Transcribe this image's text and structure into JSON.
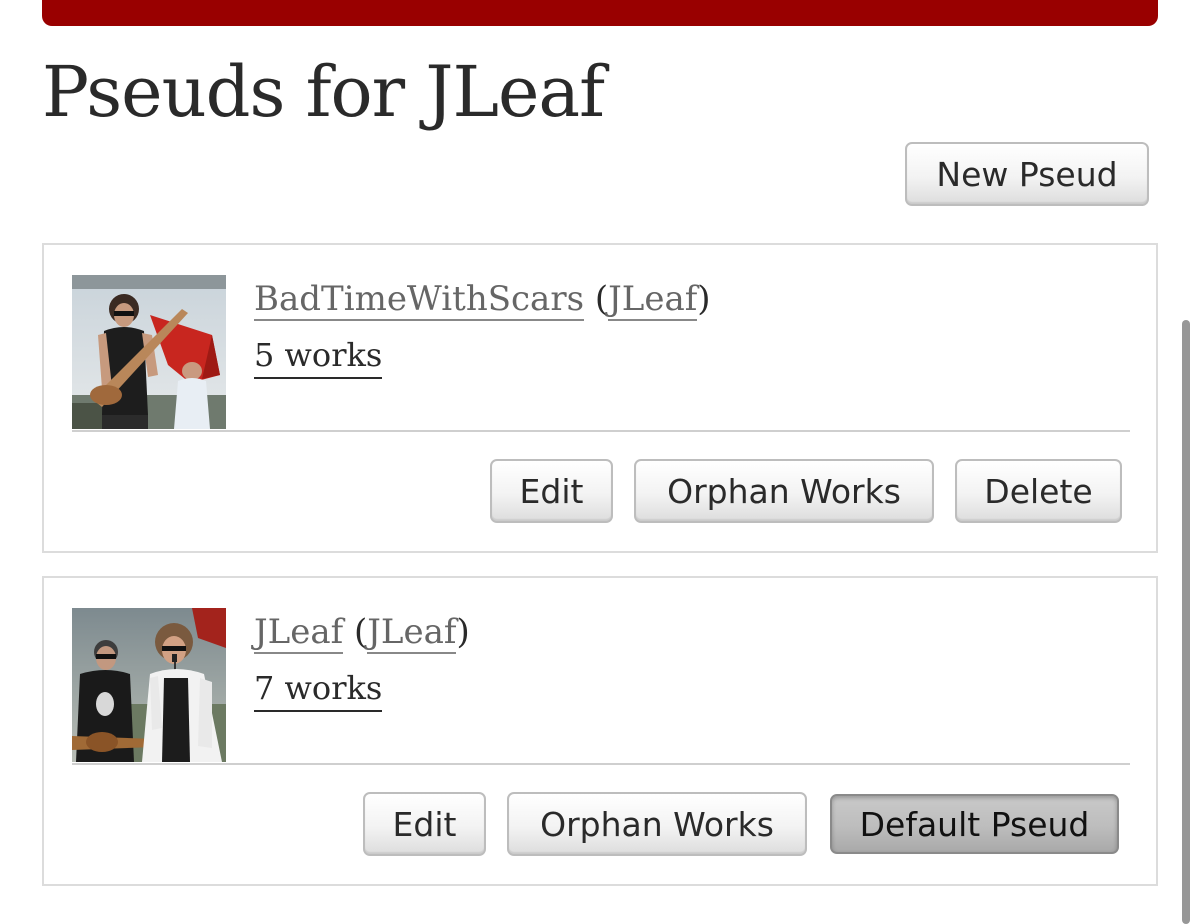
{
  "page": {
    "title": "Pseuds for JLeaf",
    "new_pseud_label": "New Pseud",
    "accent_color": "#990000"
  },
  "pseuds": [
    {
      "name": "BadTimeWithScars",
      "user_open": " (",
      "user": "JLeaf",
      "user_close": ")",
      "works": "5 works",
      "avatar": "avatar-guitarist-with-red-flag",
      "buttons": {
        "edit": "Edit",
        "orphan": "Orphan Works",
        "delete": "Delete"
      }
    },
    {
      "name": "JLeaf",
      "user_open": " (",
      "user": "JLeaf",
      "user_close": ")",
      "works": "7 works",
      "avatar": "avatar-band-performing",
      "buttons": {
        "edit": "Edit",
        "orphan": "Orphan Works",
        "default": "Default Pseud"
      }
    }
  ]
}
